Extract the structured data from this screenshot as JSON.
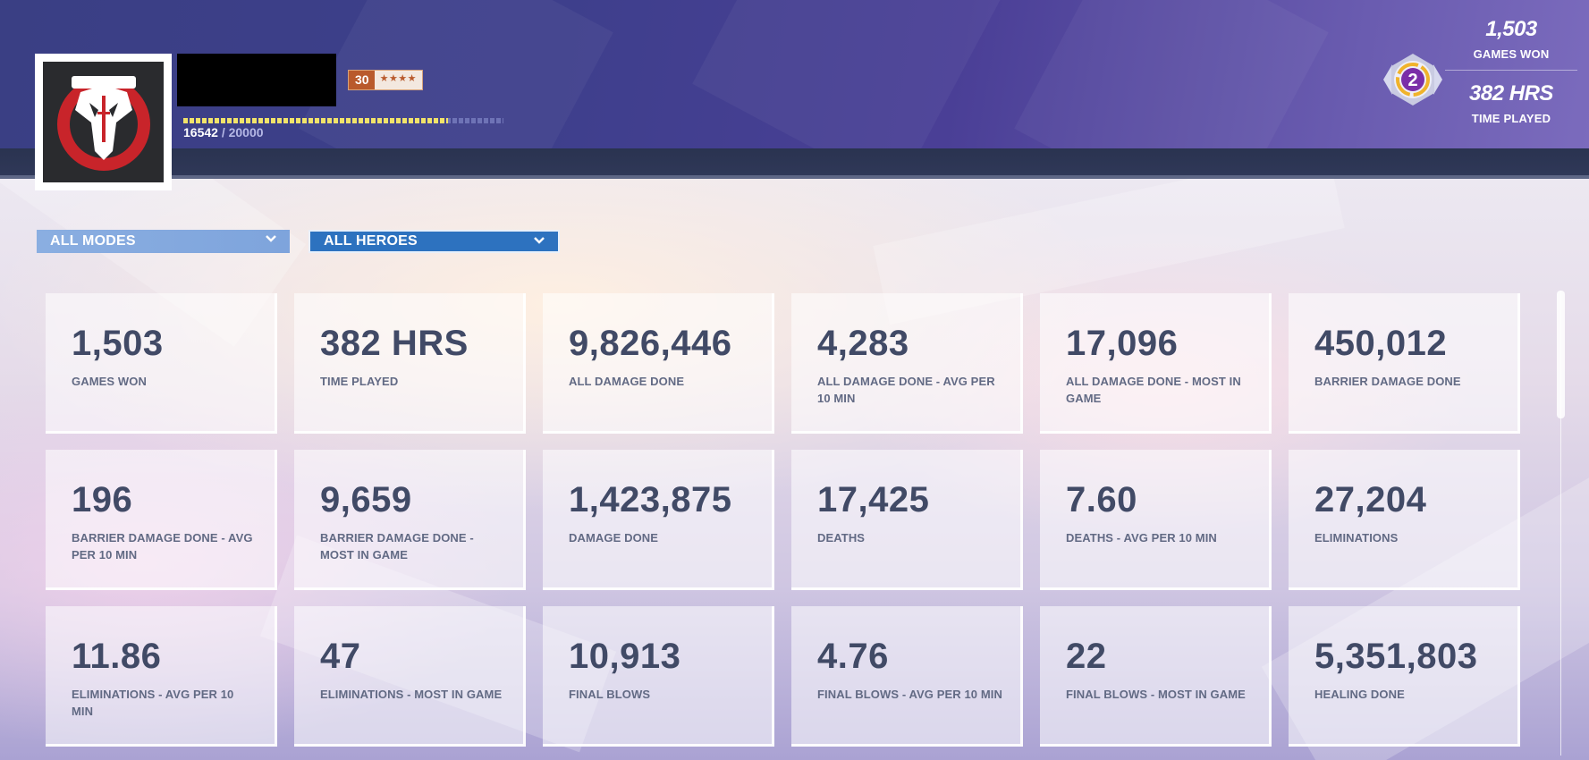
{
  "player": {
    "level": "30",
    "stars": "★★★★",
    "xp_current": "16542",
    "xp_separator": "/",
    "xp_max": "20000",
    "xp_progress": 0.827
  },
  "summary": {
    "rank_number": "2",
    "games_won_value": "1,503",
    "games_won_label": "GAMES WON",
    "time_played_value": "382 HRS",
    "time_played_label": "TIME PLAYED"
  },
  "filters": {
    "modes_label": "ALL MODES",
    "heroes_label": "ALL HEROES"
  },
  "stats": [
    {
      "value": "1,503",
      "label": "GAMES WON"
    },
    {
      "value": "382 HRS",
      "label": "TIME PLAYED"
    },
    {
      "value": "9,826,446",
      "label": "ALL DAMAGE DONE"
    },
    {
      "value": "4,283",
      "label": "ALL DAMAGE DONE - AVG PER 10 MIN"
    },
    {
      "value": "17,096",
      "label": "ALL DAMAGE DONE - MOST IN GAME"
    },
    {
      "value": "450,012",
      "label": "BARRIER DAMAGE DONE"
    },
    {
      "value": "196",
      "label": "BARRIER DAMAGE DONE - AVG PER 10 MIN"
    },
    {
      "value": "9,659",
      "label": "BARRIER DAMAGE DONE - MOST IN GAME"
    },
    {
      "value": "1,423,875",
      "label": "DAMAGE DONE"
    },
    {
      "value": "17,425",
      "label": "DEATHS"
    },
    {
      "value": "7.60",
      "label": "DEATHS - AVG PER 10 MIN"
    },
    {
      "value": "27,204",
      "label": "ELIMINATIONS"
    },
    {
      "value": "11.86",
      "label": "ELIMINATIONS - AVG PER 10 MIN"
    },
    {
      "value": "47",
      "label": "ELIMINATIONS - MOST IN GAME"
    },
    {
      "value": "10,913",
      "label": "FINAL BLOWS"
    },
    {
      "value": "4.76",
      "label": "FINAL BLOWS - AVG PER 10 MIN"
    },
    {
      "value": "22",
      "label": "FINAL BLOWS - MOST IN GAME"
    },
    {
      "value": "5,351,803",
      "label": "HEALING DONE"
    }
  ],
  "colors": {
    "header_bg": "#3e3f8c",
    "level_badge": "#b95a2c",
    "xp_fill": "#f1e36a",
    "dropdown_active": "#2d72bf",
    "dropdown_inactive": "#8aaee1",
    "stat_text": "#414a66"
  },
  "icons": {
    "avatar": "reaper-emblem-icon",
    "rank": "rank-emblem-icon",
    "dropdown": "chevron-down-icon"
  }
}
